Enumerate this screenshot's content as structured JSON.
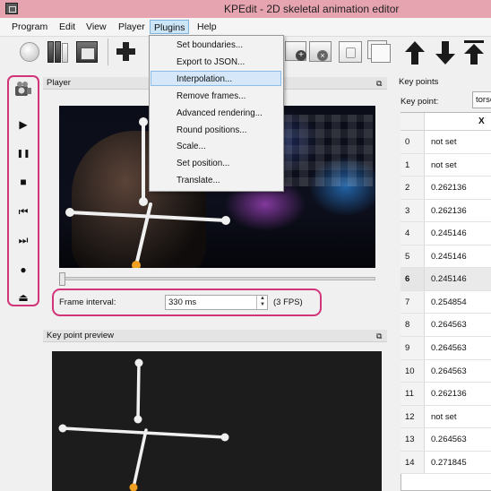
{
  "window": {
    "title": "KPEdit - 2D skeletal animation editor",
    "app_icon": "kpedit-app-icon"
  },
  "menubar": {
    "items": [
      "Program",
      "Edit",
      "View",
      "Player",
      "Plugins",
      "Help"
    ],
    "active": "Plugins"
  },
  "plugins_menu": {
    "items": [
      "Set boundaries...",
      "Export to JSON...",
      "Interpolation...",
      "Remove frames...",
      "Advanced rendering...",
      "Round positions...",
      "Scale...",
      "Set position...",
      "Translate..."
    ],
    "highlighted": "Interpolation..."
  },
  "toolbar": {
    "icons": [
      "new-frame-icon",
      "library-icon",
      "import-image-icon",
      "add-keypoint-icon",
      "add-frame-icon",
      "remove-frame-icon",
      "clear-frame-icon",
      "copy-frame-icon",
      "arrow-up-icon",
      "arrow-down-icon",
      "arrow-top-icon"
    ]
  },
  "playback_toolbar": {
    "icons": [
      "camera-icon",
      "play-icon",
      "pause-icon",
      "stop-icon",
      "skip-back-icon",
      "skip-forward-icon",
      "record-icon",
      "eject-icon"
    ],
    "glyphs": [
      "▶",
      "❚❚",
      "■",
      "⏮",
      "⏭",
      "●",
      "⏏"
    ],
    "highlight_color": "#d2347a"
  },
  "player": {
    "title": "Player",
    "dock_glyph": "⧉",
    "frame_interval_label": "Frame interval:",
    "frame_interval_value": "330 ms",
    "fps_label": "(3 FPS)",
    "spin_up": "▲",
    "spin_down": "▼"
  },
  "preview": {
    "title": "Key point preview",
    "dock_glyph": "⧉"
  },
  "keypoints": {
    "title": "Key points",
    "key_point_label": "Key point:",
    "key_point_value": "torso",
    "column_header": "X",
    "rows": [
      {
        "index": "0",
        "x": "not set"
      },
      {
        "index": "1",
        "x": "not set"
      },
      {
        "index": "2",
        "x": "0.262136"
      },
      {
        "index": "3",
        "x": "0.262136"
      },
      {
        "index": "4",
        "x": "0.245146"
      },
      {
        "index": "5",
        "x": "0.245146"
      },
      {
        "index": "6",
        "x": "0.245146"
      },
      {
        "index": "7",
        "x": "0.254854"
      },
      {
        "index": "8",
        "x": "0.264563"
      },
      {
        "index": "9",
        "x": "0.264563"
      },
      {
        "index": "10",
        "x": "0.264563"
      },
      {
        "index": "11",
        "x": "0.262136"
      },
      {
        "index": "12",
        "x": "not set"
      },
      {
        "index": "13",
        "x": "0.264563"
      },
      {
        "index": "14",
        "x": "0.271845"
      }
    ],
    "selected_index": "6"
  },
  "colors": {
    "accent": "#d2347a",
    "joint": "#f0f0f0",
    "root_joint": "#f0a020"
  }
}
